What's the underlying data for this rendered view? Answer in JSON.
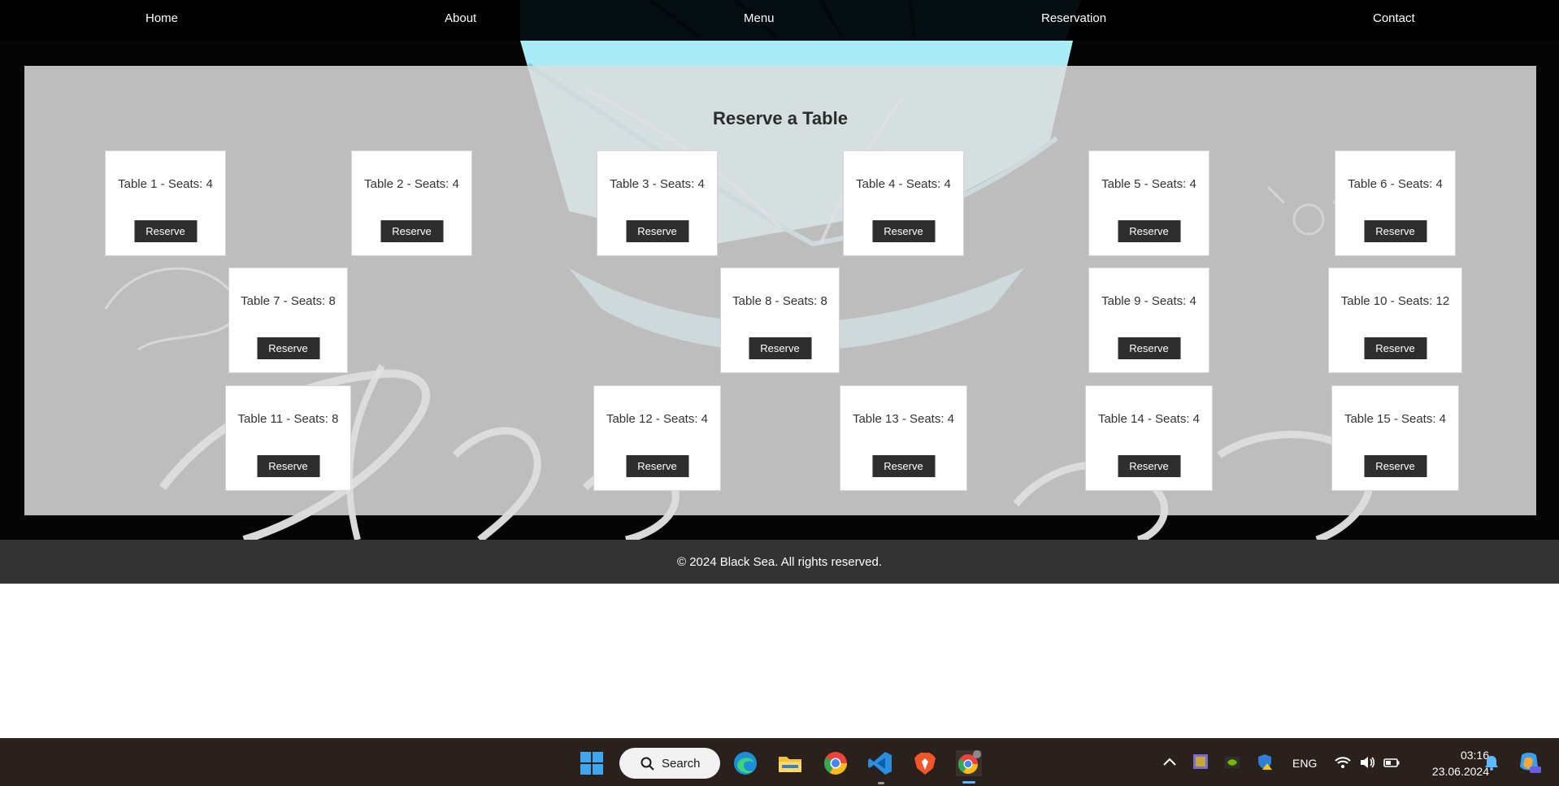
{
  "nav": {
    "items": [
      "Home",
      "About",
      "Menu",
      "Reservation",
      "Contact"
    ]
  },
  "reservation": {
    "title": "Reserve a Table",
    "button_label": "Reserve",
    "tables": [
      {
        "label": "Table 1 - Seats: 4"
      },
      {
        "label": "Table 2 - Seats: 4"
      },
      {
        "label": "Table 3 - Seats: 4"
      },
      {
        "label": "Table 4 - Seats: 4"
      },
      {
        "label": "Table 5 - Seats: 4"
      },
      {
        "label": "Table 6 - Seats: 4"
      },
      {
        "label": "Table 7 - Seats: 8"
      },
      {
        "label": "Table 8 - Seats: 8"
      },
      {
        "label": "Table 9 - Seats: 4"
      },
      {
        "label": "Table 10 - Seats: 12"
      },
      {
        "label": "Table 11 - Seats: 8"
      },
      {
        "label": "Table 12 - Seats: 4"
      },
      {
        "label": "Table 13 - Seats: 4"
      },
      {
        "label": "Table 14 - Seats: 4"
      },
      {
        "label": "Table 15 - Seats: 4"
      }
    ]
  },
  "footer": {
    "text": "© 2024 Black Sea. All rights reserved."
  },
  "taskbar": {
    "search_label": "Search",
    "language": "ENG",
    "time": "03:16",
    "date": "23.06.2024",
    "apps": [
      "start-icon",
      "edge-icon",
      "file-explorer-icon",
      "chrome-icon",
      "vscode-icon",
      "brave-icon",
      "chrome-profile-icon"
    ]
  },
  "colors": {
    "nav_bg": "#000000",
    "panel_bg": "#dcdcdc",
    "button_bg": "#2e2e2e",
    "footer_bg": "#333333",
    "taskbar_bg": "#2a201c",
    "accent": "#5cb8ff"
  }
}
